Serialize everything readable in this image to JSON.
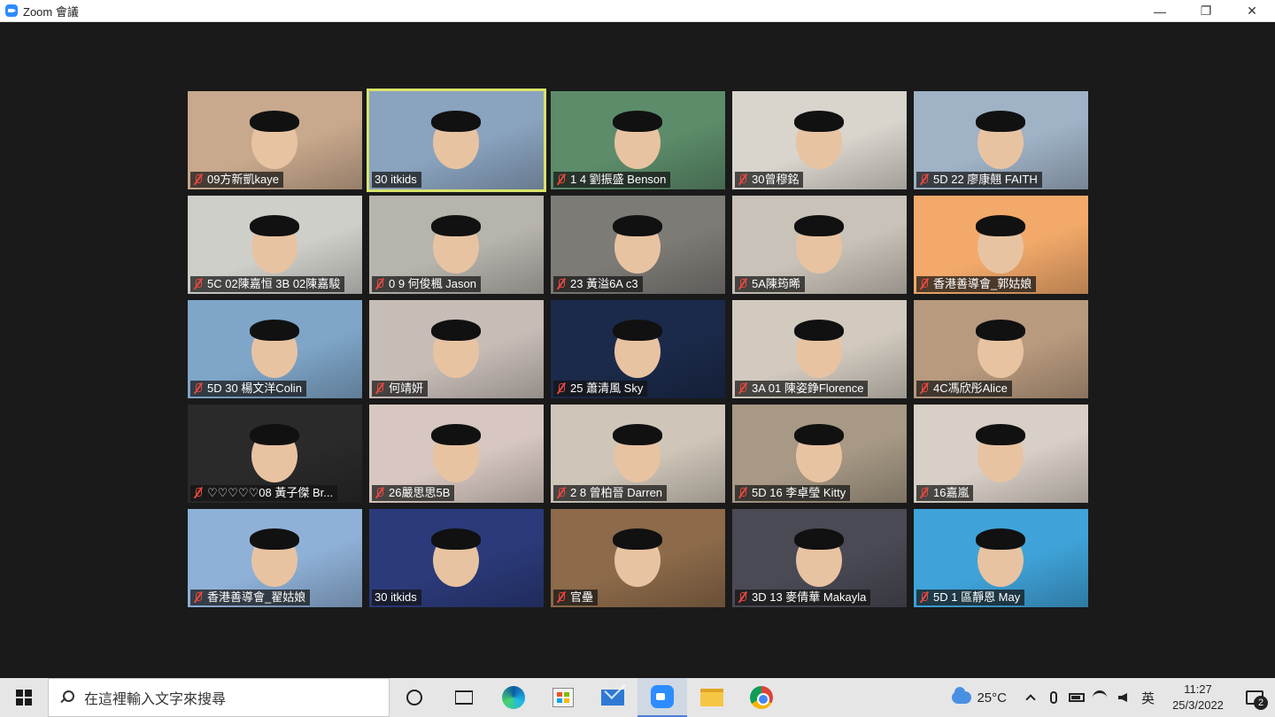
{
  "window": {
    "title": "Zoom 會議",
    "controls": {
      "minimize": "—",
      "restore": "❐",
      "close": "✕"
    }
  },
  "meeting": {
    "participants": [
      {
        "name": "09方新凱kaye",
        "muted": true,
        "bg": "#c9a98d"
      },
      {
        "name": "30 itkids",
        "muted": false,
        "bg": "#8aa3bf",
        "active": true
      },
      {
        "name": "1 4 劉振盛 Benson",
        "muted": true,
        "bg": "#5c8c6a"
      },
      {
        "name": "30曾穆銘",
        "muted": true,
        "bg": "#d9d4cc"
      },
      {
        "name": "5D 22 廖康翹 FAITH",
        "muted": true,
        "bg": "#9fb2c6"
      },
      {
        "name": "5C 02陳嘉恒 3B 02陳嘉駿",
        "muted": true,
        "bg": "#cfcfca"
      },
      {
        "name": "0 9 何俊楓 Jason",
        "muted": true,
        "bg": "#b7b3ad"
      },
      {
        "name": "23 黃溢6A c3",
        "muted": true,
        "bg": "#7d7b76"
      },
      {
        "name": "5A陳筠晞",
        "muted": true,
        "bg": "#c9c2b8"
      },
      {
        "name": "香港善導會_郭姑娘",
        "muted": true,
        "bg": "#f2a96a"
      },
      {
        "name": "5D 30 楊文洋Colin",
        "muted": true,
        "bg": "#7fa6c9"
      },
      {
        "name": "何靖妍",
        "muted": true,
        "bg": "#c7bdb7"
      },
      {
        "name": "25 蕭清風 Sky",
        "muted": true,
        "bg": "#1b2a4a"
      },
      {
        "name": "3A 01 陳姿錚Florence",
        "muted": true,
        "bg": "#d2cabf"
      },
      {
        "name": "4C馮欣彤Alice",
        "muted": true,
        "bg": "#b89a7e"
      },
      {
        "name": "♡♡♡♡♡08 黃子傑 Br...",
        "muted": true,
        "bg": "#2a2a2a"
      },
      {
        "name": "26嚴思思5B",
        "muted": true,
        "bg": "#d7c7c0"
      },
      {
        "name": "2 8 曾柏晉 Darren",
        "muted": true,
        "bg": "#cfc6b9"
      },
      {
        "name": "5D 16 李卓瑩 Kitty",
        "muted": true,
        "bg": "#a79985"
      },
      {
        "name": "16嘉嵐",
        "muted": true,
        "bg": "#d8cfc6"
      },
      {
        "name": "香港善導會_翟姑娘",
        "muted": true,
        "bg": "#8fb1d8"
      },
      {
        "name": "30 itkids",
        "muted": false,
        "bg": "#2b3a7a"
      },
      {
        "name": "官壘",
        "muted": true,
        "bg": "#8c6a4a"
      },
      {
        "name": "3D 13 麥倩華 Makayla",
        "muted": true,
        "bg": "#4a4a55"
      },
      {
        "name": "5D 1 區靜恩 May",
        "muted": true,
        "bg": "#3fa3d9"
      }
    ]
  },
  "taskbar": {
    "search_placeholder": "在這裡輸入文字來搜尋",
    "apps": [
      "cortana",
      "task-view",
      "edge",
      "store",
      "mail",
      "zoom",
      "file-explorer",
      "chrome"
    ],
    "active_app": "zoom",
    "temperature": "25°C",
    "ime": "英",
    "time": "11:27",
    "date": "25/3/2022",
    "notifications": "2"
  }
}
